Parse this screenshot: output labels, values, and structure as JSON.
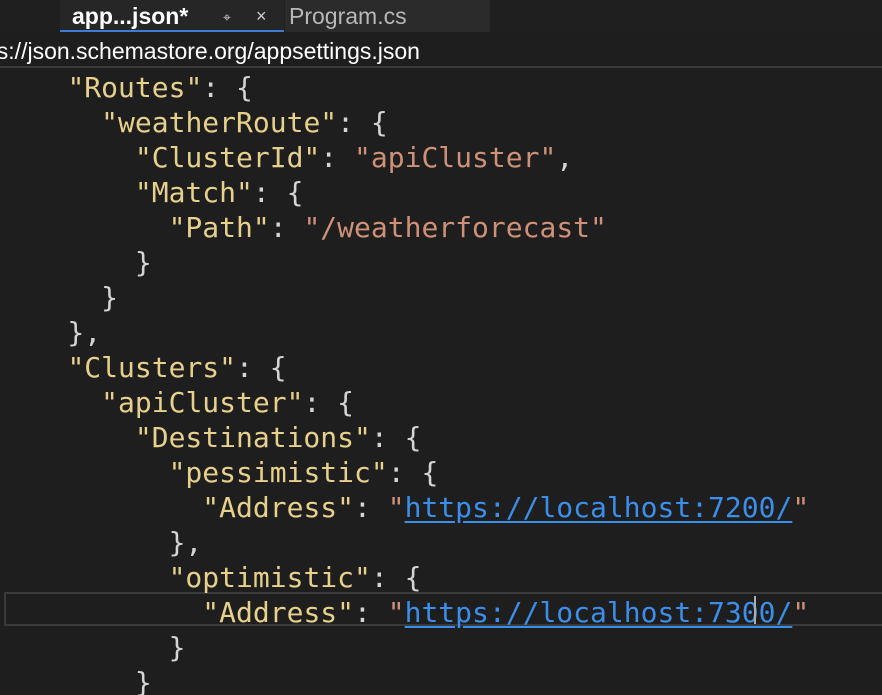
{
  "tabs": [
    {
      "label": "app...json*",
      "active": true
    },
    {
      "label": "Program.cs",
      "active": false
    }
  ],
  "tab_icons": {
    "pin": "⌖",
    "close": "×"
  },
  "schema_bar": {
    "url": "ps://json.schemastore.org/appsettings.json"
  },
  "code": {
    "routes_key": "\"Routes\"",
    "weather_route_key": "\"weatherRoute\"",
    "cluster_id_key": "\"ClusterId\"",
    "cluster_id_value": "\"apiCluster\"",
    "match_key": "\"Match\"",
    "path_key": "\"Path\"",
    "path_value": "\"/weatherforecast\"",
    "clusters_key": "\"Clusters\"",
    "api_cluster_key": "\"apiCluster\"",
    "destinations_key": "\"Destinations\"",
    "pessimistic_key": "\"pessimistic\"",
    "address_key_1": "\"Address\"",
    "address_url_1": "https://localhost:7200/",
    "optimistic_key": "\"optimistic\"",
    "address_key_2": "\"Address\"",
    "address_url_2": "https://localhost:7300/"
  },
  "colors": {
    "background": "#1e1e1e",
    "key": "#e6d08b",
    "string": "#ce9178",
    "url": "#3b8eea",
    "punctuation": "#d4d4d4"
  }
}
